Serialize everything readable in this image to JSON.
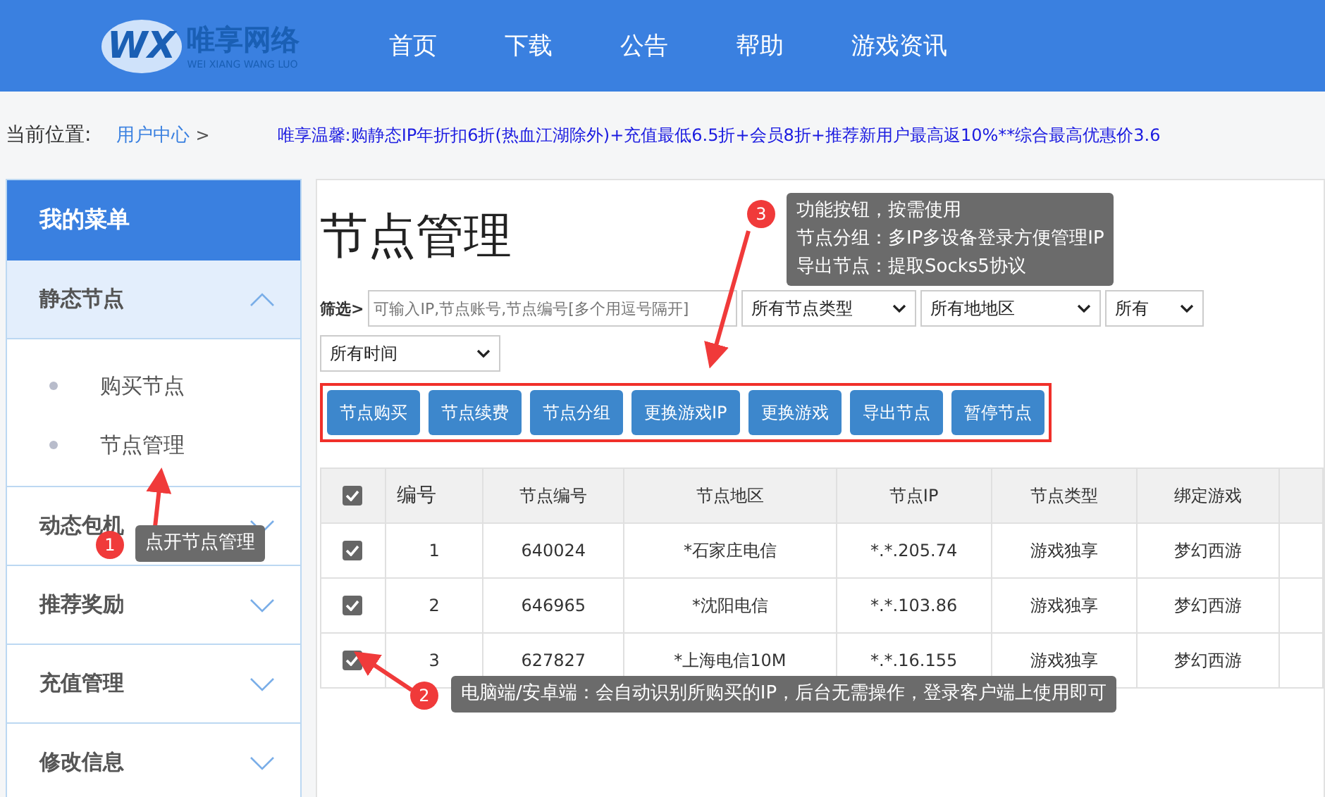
{
  "header": {
    "logo_mark": "WX",
    "logo_text": "唯享网络",
    "logo_subtext": "WEI XIANG WANG LUO",
    "nav": [
      "首页",
      "下载",
      "公告",
      "帮助",
      "游戏资讯"
    ]
  },
  "breadcrumb": {
    "label": "当前位置:",
    "link": "用户中心",
    "separator": ">"
  },
  "notice": "唯享温馨:购静态IP年折扣6折(热血江湖除外)+充值最低6.5折+会员8折+推荐新用户最高返10%**综合最高优惠价3.6",
  "sidebar": {
    "title": "我的菜单",
    "groups": [
      {
        "label": "静态节点",
        "expanded": true,
        "children": [
          {
            "label": "购买节点"
          },
          {
            "label": "节点管理"
          }
        ]
      },
      {
        "label": "动态包机",
        "expanded": false
      },
      {
        "label": "推荐奖励",
        "expanded": false
      },
      {
        "label": "充值管理",
        "expanded": false
      },
      {
        "label": "修改信息",
        "expanded": false
      }
    ]
  },
  "page": {
    "title": "节点管理",
    "filter_label": "筛选>",
    "search": {
      "placeholder": "可输入IP,节点账号,节点编号[多个用逗号隔开]"
    },
    "selects": [
      "所有节点类型",
      "所有地地区",
      "所有",
      "所有时间"
    ],
    "actions": [
      "节点购买",
      "节点续费",
      "节点分组",
      "更换游戏IP",
      "更换游戏",
      "导出节点",
      "暂停节点"
    ]
  },
  "table": {
    "header_checked": true,
    "columns": [
      "编号",
      "节点编号",
      "节点地区",
      "节点IP",
      "节点类型",
      "绑定游戏"
    ],
    "rows": [
      {
        "checked": true,
        "cells": [
          "1",
          "640024",
          "*石家庄电信",
          "*.*.205.74",
          "游戏独享",
          "梦幻西游"
        ]
      },
      {
        "checked": true,
        "cells": [
          "2",
          "646965",
          "*沈阳电信",
          "*.*.103.86",
          "游戏独享",
          "梦幻西游"
        ]
      },
      {
        "checked": true,
        "cells": [
          "3",
          "627827",
          "*上海电信10M",
          "*.*.16.155",
          "游戏独享",
          "梦幻西游"
        ]
      }
    ]
  },
  "annotations": [
    {
      "number": "3",
      "lines": [
        "功能按钮，按需使用",
        "节点分组：多IP多设备登录方便管理IP",
        "导出节点：提取Socks5协议"
      ]
    },
    {
      "number": "1",
      "lines": [
        "点开节点管理"
      ]
    },
    {
      "number": "2",
      "lines": [
        "电脑端/安卓端：会自动识别所购买的IP，后台无需操作，登录客户端上使用即可"
      ]
    }
  ]
}
